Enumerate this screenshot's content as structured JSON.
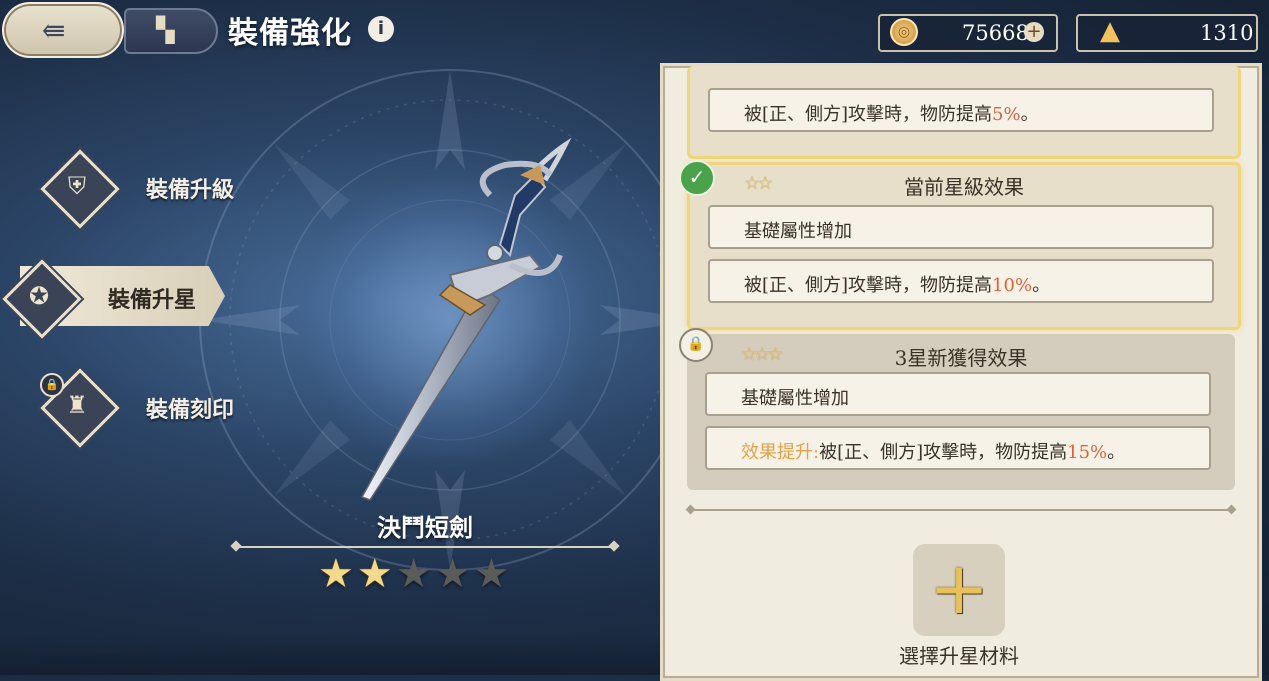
{
  "header": {
    "title": "裝備強化",
    "back_icon": "back-arrow-icon",
    "home_icon": "home-grid-icon",
    "info_glyph": "i"
  },
  "currencies": [
    {
      "icon": "gold-coin-icon",
      "value": "75668",
      "add": "+"
    },
    {
      "icon": "star-crystal-icon",
      "value": "1310"
    }
  ],
  "menu": {
    "items": [
      {
        "label": "裝備升級",
        "icon": "upgrade-icon",
        "active": false,
        "locked": false
      },
      {
        "label": "裝備升星",
        "icon": "star-upgrade-icon",
        "active": true,
        "locked": false
      },
      {
        "label": "裝備刻印",
        "icon": "engrave-icon",
        "active": false,
        "locked": true
      }
    ]
  },
  "weapon": {
    "name": "決鬥短劍",
    "stars_total": 5,
    "stars_filled": 2
  },
  "effects": {
    "prev_row": {
      "prefix": "被[正、側方]攻擊時，物防提高",
      "value": "5%",
      "suffix": "。"
    },
    "current": {
      "header": "當前星級效果",
      "stars": "☆☆",
      "row1": "基礎屬性增加",
      "row2": {
        "prefix": "被[正、側方]攻擊時，物防提高",
        "value": "10%",
        "suffix": "。"
      }
    },
    "next": {
      "header": "3星新獲得效果",
      "stars": "☆☆☆",
      "row1": "基礎屬性增加",
      "row2": {
        "tag": "效果提升:",
        "prefix": "被[正、側方]攻擊時，物防提高",
        "value": "15%",
        "suffix": "。"
      }
    }
  },
  "materials": {
    "add_glyph": "+",
    "label": "選擇升星材料"
  },
  "colors": {
    "accent_gold": "#f1d57d",
    "highlight": "#d9643c",
    "tag": "#e3a24a",
    "check_green": "#4aa34a"
  }
}
